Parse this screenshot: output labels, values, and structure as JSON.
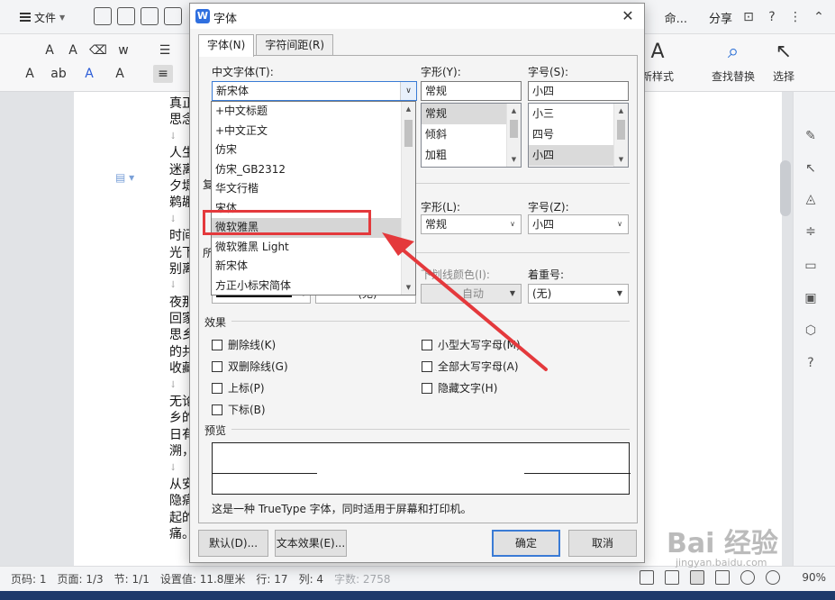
{
  "app": {
    "menu": {
      "file_label": "文件"
    },
    "top_right": {
      "truncated_text": "命...",
      "share_label": "分享"
    },
    "ribbon": {
      "new_style_label": "新样式",
      "find_replace_label": "查找替换",
      "select_label": "选择",
      "font_glyphs": [
        "A",
        "A",
        "A",
        "ab",
        "A",
        "A"
      ]
    },
    "document": {
      "lines": [
        "真正",
        "思念",
        "↓",
        "人生",
        "迷离",
        "夕堤",
        "鹈鹕",
        "↓",
        "时间",
        "光下",
        "别离",
        "↓",
        "夜那",
        "回家",
        "思乡",
        "的共",
        "收藏",
        "↓",
        "无论",
        "乡的",
        "日有",
        "溯，",
        "↓",
        "从安",
        "隐痛",
        "起的",
        "痛。"
      ]
    },
    "status_bar": {
      "page_code": "页码: 1",
      "page": "页面: 1/3",
      "section": "节: 1/1",
      "setting": "设置值: 11.8厘米",
      "row": "行: 17",
      "col": "列: 4",
      "word_count": "字数: 2758",
      "zoom": "90%"
    },
    "colors": {
      "accent": "#3a7bd5",
      "annotation": "#e4393c",
      "taskbar": "#1e3a6b"
    }
  },
  "dialog": {
    "title": "字体",
    "close_icon": "close-icon",
    "tabs": [
      {
        "label": "字体(N)",
        "active": true
      },
      {
        "label": "字符间距(R)",
        "active": false
      }
    ],
    "chinese_font": {
      "label": "中文字体(T):",
      "value": "新宋体",
      "dropdown_items": [
        "+中文标题",
        "+中文正文",
        "仿宋",
        "仿宋_GB2312",
        "华文行楷",
        "宋体",
        "微软雅黑",
        "微软雅黑 Light",
        "新宋体",
        "方正小标宋简体"
      ],
      "highlighted": "微软雅黑"
    },
    "style": {
      "label": "字形(Y):",
      "value": "常规",
      "options": [
        "常规",
        "倾斜",
        "加粗"
      ],
      "selected": "常规"
    },
    "size": {
      "label": "字号(S):",
      "value": "小四",
      "options": [
        "小三",
        "四号",
        "小四"
      ],
      "selected": "小四"
    },
    "partial_labels": {
      "complex": "复",
      "all": "所"
    },
    "complex_style": {
      "label": "字形(L):",
      "value": "常规"
    },
    "complex_size": {
      "label": "字号(Z):",
      "value": "小四"
    },
    "underline_color": {
      "label": "下划线颜色(I):",
      "value": "自动"
    },
    "emphasis": {
      "label": "着重号:",
      "value": "(无)"
    },
    "underline_style": {
      "value": "(无)"
    },
    "effects": {
      "title": "效果",
      "left": [
        "删除线(K)",
        "双删除线(G)",
        "上标(P)",
        "下标(B)"
      ],
      "right": [
        "小型大写字母(M)",
        "全部大写字母(A)",
        "隐藏文字(H)"
      ]
    },
    "preview": {
      "title": "预览",
      "note": "这是一种 TrueType 字体，同时适用于屏幕和打印机。"
    },
    "buttons": {
      "default": "默认(D)...",
      "text_effects": "文本效果(E)...",
      "ok": "确定",
      "cancel": "取消"
    }
  },
  "watermark": {
    "main": "Bai 经验",
    "sub": "jingyan.baidu.com"
  }
}
